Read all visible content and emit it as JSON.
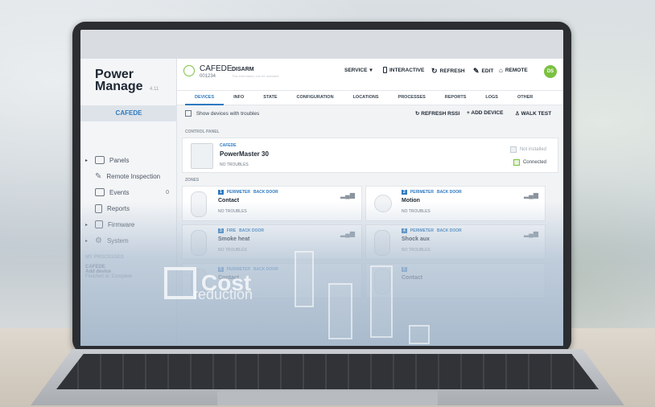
{
  "app": {
    "brand": "Power Manage",
    "brand_version": "4.11"
  },
  "sidebar": {
    "selected": "CAFEDE",
    "items": [
      {
        "label": "Panels",
        "icon": "panel-icon",
        "expandable": true
      },
      {
        "label": "Remote Inspection",
        "icon": "inspection-icon",
        "expandable": false
      },
      {
        "label": "Events",
        "icon": "events-icon",
        "expandable": false,
        "count": "0"
      },
      {
        "label": "Reports",
        "icon": "reports-icon",
        "expandable": false
      },
      {
        "label": "Firmware",
        "icon": "firmware-icon",
        "expandable": true
      },
      {
        "label": "System",
        "icon": "gear-icon",
        "expandable": true
      }
    ],
    "processes_title": "MY PROCESSES",
    "process_panel": "CAFEDE",
    "process_action": "Add device",
    "process_status": "Finished at: Complete"
  },
  "header": {
    "panel_name": "CAFEDE",
    "panel_id": "001234",
    "state": "DISARM",
    "state_sub": "This information can be outdated",
    "service": "SERVICE",
    "interactive": "INTERACTIVE",
    "refresh": "REFRESH",
    "edit": "EDIT",
    "remote": "REMOTE",
    "avatar": "DS"
  },
  "tabs": [
    "DEVICES",
    "INFO",
    "STATE",
    "CONFIGURATION",
    "LOCATIONS",
    "PROCESSES",
    "REPORTS",
    "LOGS",
    "OTHER"
  ],
  "devices": {
    "show_troubles": "Show devices with troubles",
    "refresh_rssi": "REFRESH RSSI",
    "add_device": "ADD DEVICE",
    "walk_test": "WALK TEST",
    "control_panel_title": "CONTROL PANEL",
    "control_panel": {
      "sub": "CAFEDE",
      "name": "PowerMaster 30",
      "status": "NO TROUBLES",
      "not_installed": "Not installed",
      "connected": "Connected"
    },
    "zones_title": "ZONES",
    "zones": [
      {
        "num": "1",
        "type": "PERIMETER",
        "location": "BACK DOOR",
        "name": "Contact",
        "status": "NO TROUBLES"
      },
      {
        "num": "2",
        "type": "PERIMETER",
        "location": "BACK DOOR",
        "name": "Motion",
        "status": "NO TROUBLES"
      },
      {
        "num": "3",
        "type": "FIRE",
        "location": "BACK DOOR",
        "name": "Smoke heat",
        "status": "NO TROUBLES"
      },
      {
        "num": "4",
        "type": "PERIMETER",
        "location": "BACK DOOR",
        "name": "Shock aux",
        "status": "NO TROUBLES"
      },
      {
        "num": "5",
        "type": "PERIMETER",
        "location": "BACK DOOR",
        "name": "Contact",
        "status": ""
      },
      {
        "num": "6",
        "type": "",
        "location": "",
        "name": "Contact",
        "status": ""
      }
    ]
  },
  "overlay": {
    "line1": "Cost",
    "line2": "reduction"
  },
  "colors": {
    "accent": "#2f7ac0",
    "ok": "#7bc142"
  }
}
